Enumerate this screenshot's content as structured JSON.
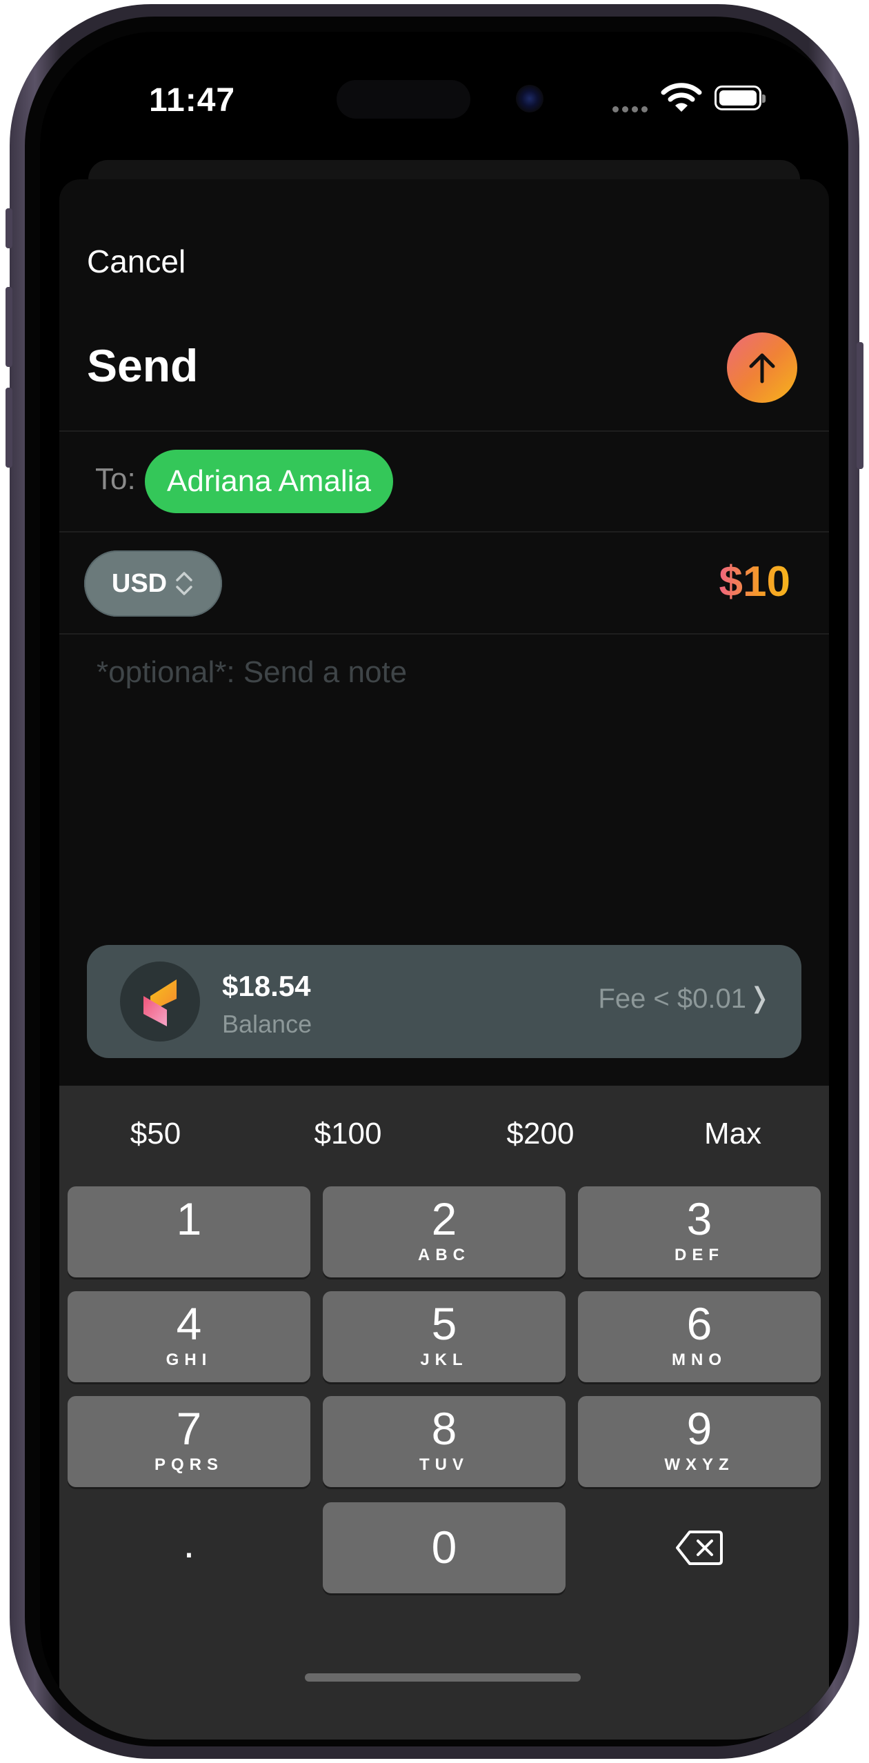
{
  "status_bar": {
    "time": "11:47"
  },
  "header": {
    "cancel_label": "Cancel",
    "title": "Send"
  },
  "recipient": {
    "to_label": "To:",
    "name": "Adriana Amalia"
  },
  "amount_row": {
    "currency": "USD",
    "amount": "$10"
  },
  "note": {
    "placeholder": "*optional*: Send a note"
  },
  "balance_card": {
    "balance": "$18.54",
    "balance_label": "Balance",
    "fee": "Fee < $0.01"
  },
  "quick_amounts": [
    "$50",
    "$100",
    "$200",
    "Max"
  ],
  "keypad": {
    "k1": {
      "digit": "1",
      "letters": ""
    },
    "k2": {
      "digit": "2",
      "letters": "ABC"
    },
    "k3": {
      "digit": "3",
      "letters": "DEF"
    },
    "k4": {
      "digit": "4",
      "letters": "GHI"
    },
    "k5": {
      "digit": "5",
      "letters": "JKL"
    },
    "k6": {
      "digit": "6",
      "letters": "MNO"
    },
    "k7": {
      "digit": "7",
      "letters": "PQRS"
    },
    "k8": {
      "digit": "8",
      "letters": "TUV"
    },
    "k9": {
      "digit": "9",
      "letters": "WXYZ"
    },
    "k0": {
      "digit": "0"
    },
    "decimal": "."
  },
  "icons": {
    "send": "arrow-up-icon",
    "currency": "chevron-up-down-icon",
    "balance": "app-logo-icon",
    "delete": "delete-backspace-icon"
  },
  "colors": {
    "accent_green": "#34c759",
    "gradient_start": "#ec6a7a",
    "gradient_end": "#f6b41b",
    "keyboard_bg": "#2c2c2c",
    "key_bg": "#6b6b6b"
  }
}
